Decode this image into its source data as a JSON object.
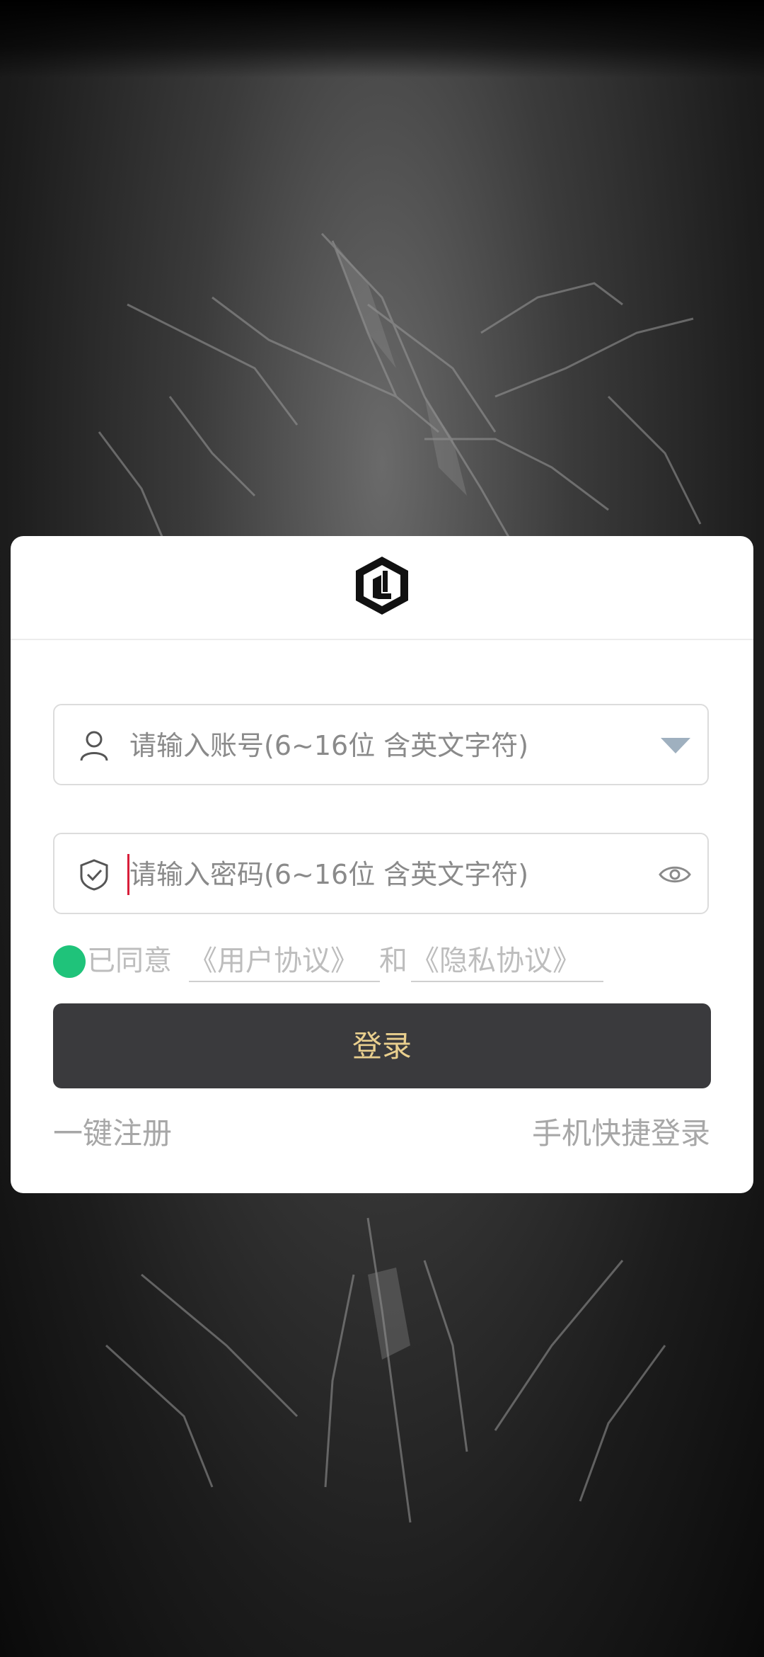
{
  "login": {
    "account_placeholder": "请输入账号(6~16位 含英文字符)",
    "password_placeholder": "请输入密码(6~16位 含英文字符)",
    "agree_prefix": "已同意",
    "user_agreement": "《用户协议》",
    "agree_and": "和",
    "privacy_agreement": "《隐私协议》",
    "login_button": "登录",
    "register_link": "一键注册",
    "phone_login_link": "手机快捷登录"
  },
  "icons": {
    "logo": "brand-logo-icon",
    "account": "user-icon",
    "password": "shield-check-icon",
    "dropdown": "chevron-down-icon",
    "visibility": "eye-icon"
  },
  "colors": {
    "button_bg": "#3a3a3d",
    "button_text": "#e9cf8e",
    "agree_dot": "#1fc37a",
    "cursor": "#d81e3a"
  }
}
